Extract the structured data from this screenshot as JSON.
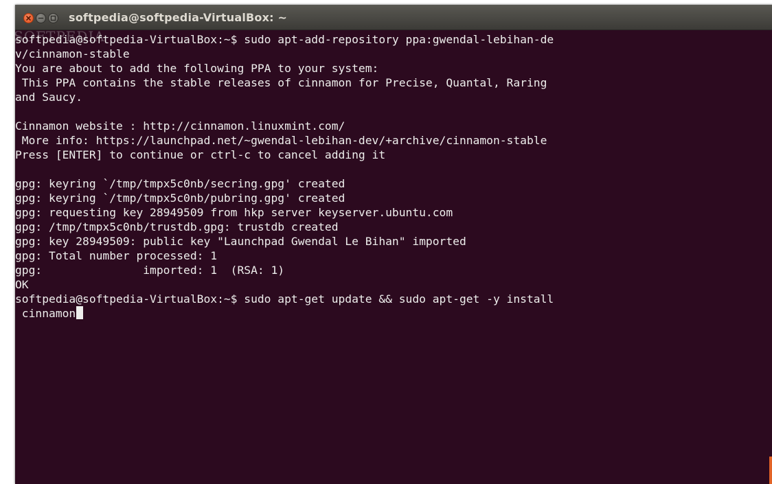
{
  "window": {
    "title": "softpedia@softpedia-VirtualBox: ~",
    "close_icon": "close-icon",
    "minimize_icon": "minimize-icon",
    "maximize_icon": "maximize-icon"
  },
  "watermark": "SOFTPEDIA",
  "terminal": {
    "lines": [
      "softpedia@softpedia-VirtualBox:~$ sudo apt-add-repository ppa:gwendal-lebihan-de",
      "v/cinnamon-stable",
      "You are about to add the following PPA to your system:",
      " This PPA contains the stable releases of cinnamon for Precise, Quantal, Raring",
      "and Saucy.",
      "",
      "Cinnamon website : http://cinnamon.linuxmint.com/",
      " More info: https://launchpad.net/~gwendal-lebihan-dev/+archive/cinnamon-stable",
      "Press [ENTER] to continue or ctrl-c to cancel adding it",
      "",
      "gpg: keyring `/tmp/tmpx5c0nb/secring.gpg' created",
      "gpg: keyring `/tmp/tmpx5c0nb/pubring.gpg' created",
      "gpg: requesting key 28949509 from hkp server keyserver.ubuntu.com",
      "gpg: /tmp/tmpx5c0nb/trustdb.gpg: trustdb created",
      "gpg: key 28949509: public key \"Launchpad Gwendal Le Bihan\" imported",
      "gpg: Total number processed: 1",
      "gpg:               imported: 1  (RSA: 1)",
      "OK",
      "softpedia@softpedia-VirtualBox:~$ sudo apt-get update && sudo apt-get -y install",
      " cinnamon"
    ]
  },
  "colors": {
    "background": "#2c0a1f",
    "text": "#eeeeec",
    "titlebar": "#3c3b37",
    "scroll_accent": "#e16327"
  }
}
